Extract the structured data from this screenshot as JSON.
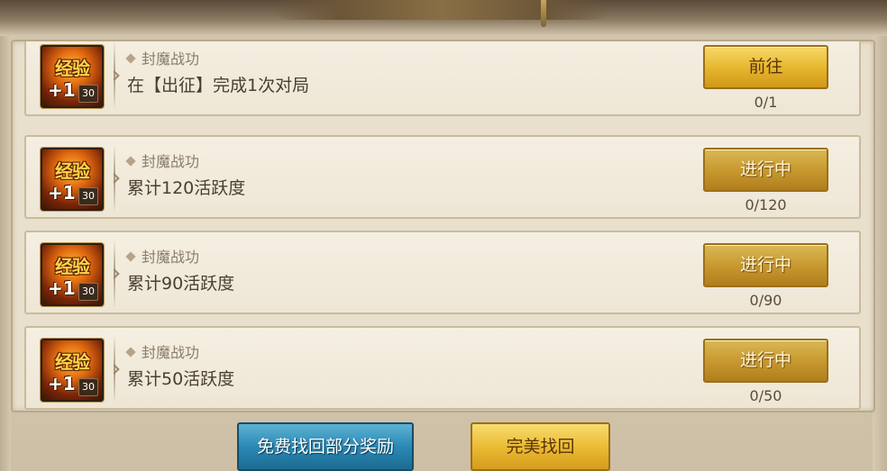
{
  "tasks": [
    {
      "icon_text": "经验",
      "icon_plus": "+1",
      "icon_count": "30",
      "category": "封魔战功",
      "description": "在【出征】完成1次对局",
      "button_label": "前往",
      "button_state": "go",
      "progress": "0/1"
    },
    {
      "icon_text": "经验",
      "icon_plus": "+1",
      "icon_count": "30",
      "category": "封魔战功",
      "description": "累计120活跃度",
      "button_label": "进行中",
      "button_state": "in-progress",
      "progress": "0/120"
    },
    {
      "icon_text": "经验",
      "icon_plus": "+1",
      "icon_count": "30",
      "category": "封魔战功",
      "description": "累计90活跃度",
      "button_label": "进行中",
      "button_state": "in-progress",
      "progress": "0/90"
    },
    {
      "icon_text": "经验",
      "icon_plus": "+1",
      "icon_count": "30",
      "category": "封魔战功",
      "description": "累计50活跃度",
      "button_label": "进行中",
      "button_state": "in-progress",
      "progress": "0/50"
    }
  ],
  "footer": {
    "free_recover_label": "免费找回部分奖励",
    "perfect_recover_label": "完美找回"
  },
  "colors": {
    "gold_button": "#e8b830",
    "blue_button": "#2a89b5",
    "panel_bg": "#e8dfcd"
  }
}
